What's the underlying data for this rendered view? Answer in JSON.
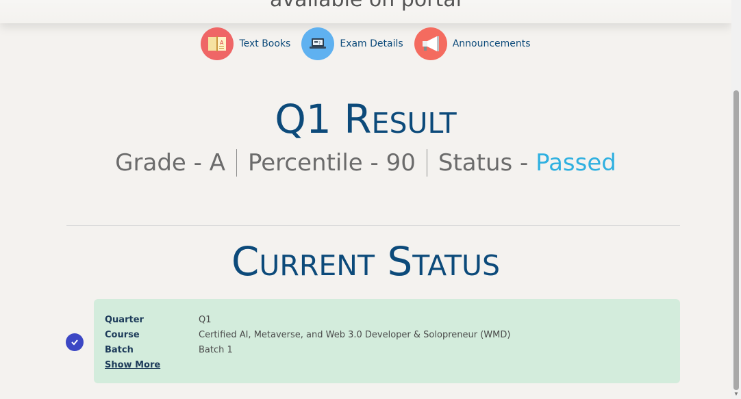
{
  "header": {
    "partial_text": "available on portal"
  },
  "quick_links": [
    {
      "label": "Text Books",
      "icon": "textbook-icon",
      "color": "#ef6666"
    },
    {
      "label": "Exam Details",
      "icon": "laptop-icon",
      "color": "#5fb1f0"
    },
    {
      "label": "Announcements",
      "icon": "megaphone-icon",
      "color": "#f46b5f"
    }
  ],
  "result": {
    "title": "Q1 Result",
    "grade": "Grade - A",
    "percentile": "Percentile - 90",
    "status_prefix": "Status - ",
    "status_value": "Passed",
    "status_color": "#2fb0e0"
  },
  "current_status": {
    "title": "Current Status",
    "rows": [
      {
        "key": "Quarter",
        "value": "Q1"
      },
      {
        "key": "Course",
        "value": "Certified AI, Metaverse, and Web 3.0 Developer & Solopreneur (WMD)"
      },
      {
        "key": "Batch",
        "value": "Batch 1"
      }
    ],
    "show_more": "Show More",
    "card_color": "#d3ecdc",
    "check_color": "#3c47c4"
  },
  "colors": {
    "heading": "#0c4a7a",
    "background": "#f4f2ef"
  }
}
